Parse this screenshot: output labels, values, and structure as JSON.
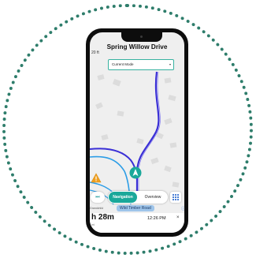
{
  "header": {
    "street_title": "Spring Willow Drive",
    "distance": "20 ft"
  },
  "mode_select": {
    "selected": "Current Mode",
    "caret": "▾"
  },
  "controls": {
    "skip_icon": "⏭",
    "navigation_label": "Navigation",
    "overview_label": "Overview"
  },
  "road": {
    "current": "Wild Timber Road",
    "previous": "Grandchild"
  },
  "trip": {
    "eta_duration": "h 28m",
    "eta_sub": "mi",
    "clock": "12:26 PM",
    "close_glyph": "×",
    "info_glyph": "ⓘ"
  },
  "colors": {
    "route_primary": "#3a2fd6",
    "route_secondary": "#2c9de6",
    "accent": "#1aa89a",
    "ring": "#2e7d6b"
  }
}
